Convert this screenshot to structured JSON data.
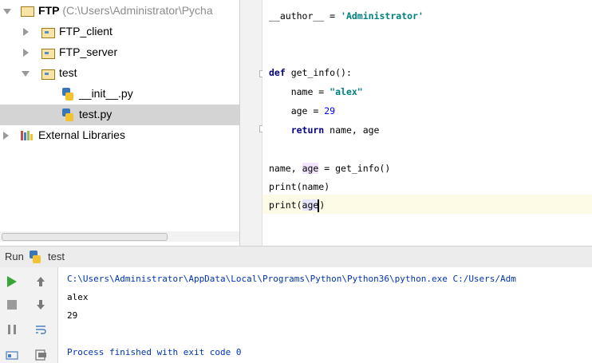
{
  "project_tree": {
    "root": {
      "name": "FTP",
      "path": "(C:\\Users\\Administrator\\Pycha"
    },
    "items": [
      {
        "label": "FTP_client"
      },
      {
        "label": "FTP_server"
      },
      {
        "label": "test"
      },
      {
        "label": "__init__.py"
      },
      {
        "label": "test.py"
      },
      {
        "label": "External Libraries"
      }
    ]
  },
  "editor": {
    "line1": {
      "a": "__author__",
      "b": " = ",
      "c": "'Administrator'"
    },
    "line2": {
      "kw": "def",
      "rest": " get_info():"
    },
    "line3": {
      "a": "    name = ",
      "b": "\"alex\""
    },
    "line4": {
      "a": "    age = ",
      "b": "29"
    },
    "line5": {
      "kw": "    return",
      "rest": " name, age"
    },
    "line6": {
      "a": "name",
      "b": ", ",
      "c": "age",
      "d": " = get_info()"
    },
    "line7": {
      "a": "print(name)"
    },
    "line8": {
      "a": "print(",
      "b": "age",
      "c": ")"
    }
  },
  "run_panel": {
    "title": "Run",
    "config": "test",
    "output": [
      "C:\\Users\\Administrator\\AppData\\Local\\Programs\\Python\\Python36\\python.exe C:/Users/Adm",
      "alex",
      "29",
      "",
      "Process finished with exit code 0"
    ]
  },
  "colors": {
    "run_green": "#3aa538",
    "keyword": "#000080",
    "string": "#008080",
    "number": "#0000ff"
  }
}
